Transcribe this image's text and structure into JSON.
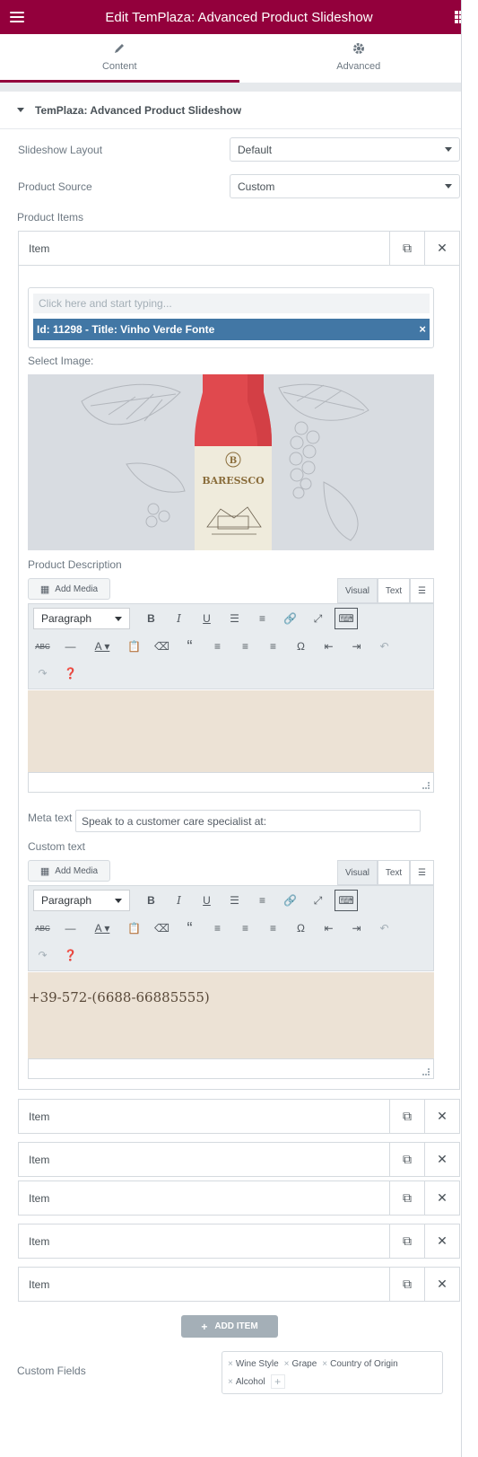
{
  "header": {
    "title": "Edit TemPlaza: Advanced Product Slideshow",
    "menu_icon": "hamburger-icon",
    "grid_icon": "apps-grid-icon"
  },
  "tabs": [
    {
      "label": "Content",
      "icon": "pencil-icon",
      "active": true
    },
    {
      "label": "Advanced",
      "icon": "gear-icon",
      "active": false
    }
  ],
  "section": {
    "title": "TemPlaza: Advanced Product Slideshow"
  },
  "controls": {
    "slideshow_layout": {
      "label": "Slideshow Layout",
      "value": "Default"
    },
    "product_source": {
      "label": "Product Source",
      "value": "Custom"
    },
    "product_items_label": "Product Items"
  },
  "item_label": "Item",
  "expanded_item": {
    "search_placeholder": "Click here and start typing...",
    "selected_product": "Id: 11298 - Title: Vinho Verde Fonte",
    "select_image_label": "Select Image:",
    "image": {
      "brand": "BARESSCO",
      "monogram": "B"
    },
    "product_description_label": "Product Description",
    "meta_text_label": "Meta text",
    "meta_text_value": "Speak to a customer care specialist at:",
    "custom_text_label": "Custom text",
    "custom_text_value": "+39-572-(6688-66885555)"
  },
  "editor": {
    "add_media": "Add Media",
    "tab_visual": "Visual",
    "tab_text": "Text",
    "format": "Paragraph"
  },
  "add_item_label": "ADD ITEM",
  "custom_fields": {
    "label": "Custom Fields",
    "tags": [
      "Wine Style",
      "Grape",
      "Country of Origin",
      "Alcohol"
    ]
  },
  "colors": {
    "brand": "#93003c",
    "chip": "#4277a5",
    "editor_bg": "#ece2d5"
  }
}
